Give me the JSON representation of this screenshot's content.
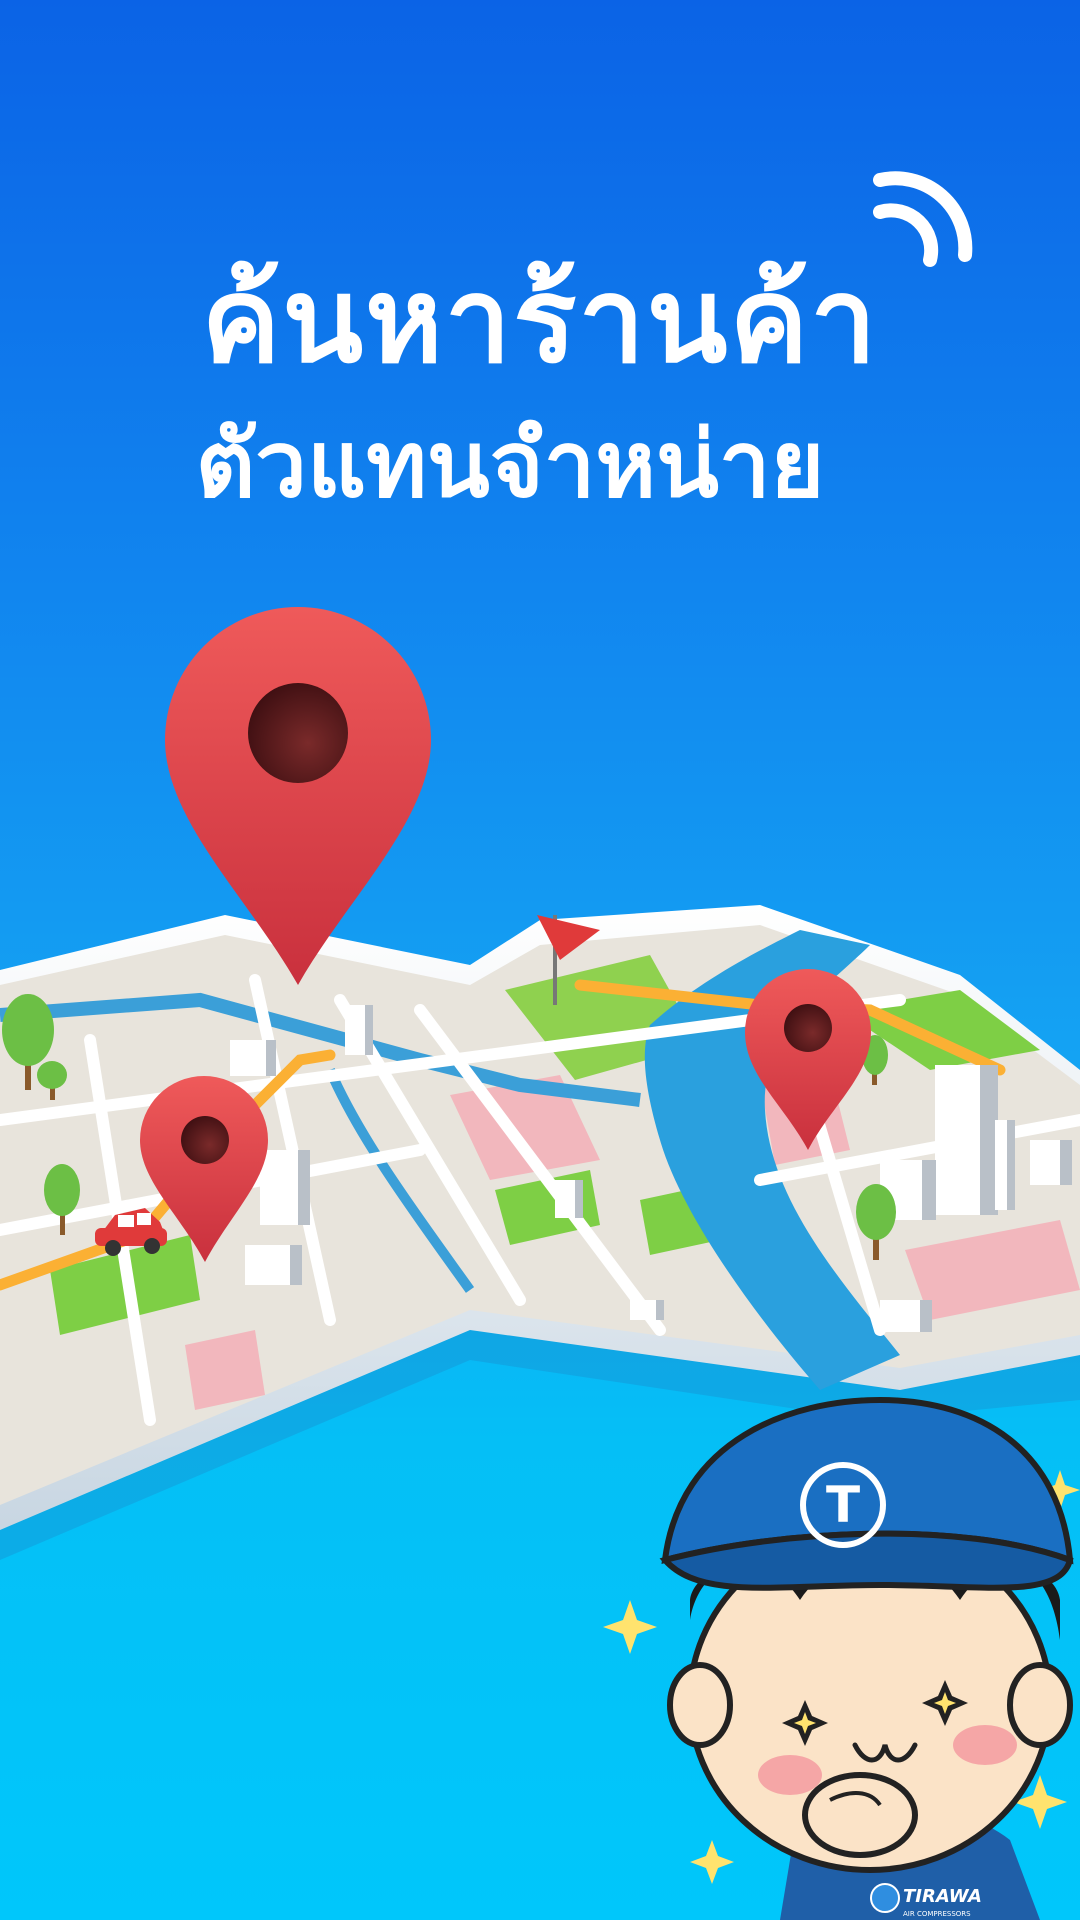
{
  "splash": {
    "headline_line1": "ค้นหาร้านค้า",
    "headline_line2": "ตัวแทนจำหน่าย"
  },
  "icons": {
    "signal": "wifi-signal-icon",
    "pin": "map-pin-icon",
    "flag": "flag-icon",
    "car": "car-icon",
    "sparkle": "sparkle-icon"
  },
  "mascot": {
    "cap_letter": "T",
    "shirt_brand": "TIRAWA",
    "shirt_tagline": "AIR COMPRESSORS"
  },
  "colors": {
    "background_top": "#0b63e6",
    "background_bottom": "#00c7fb",
    "pin_red": "#e2454b",
    "map_land": "#e8e4dc",
    "river": "#2aa0de",
    "road": "#fbb034",
    "cap_blue": "#1a6fc2"
  }
}
